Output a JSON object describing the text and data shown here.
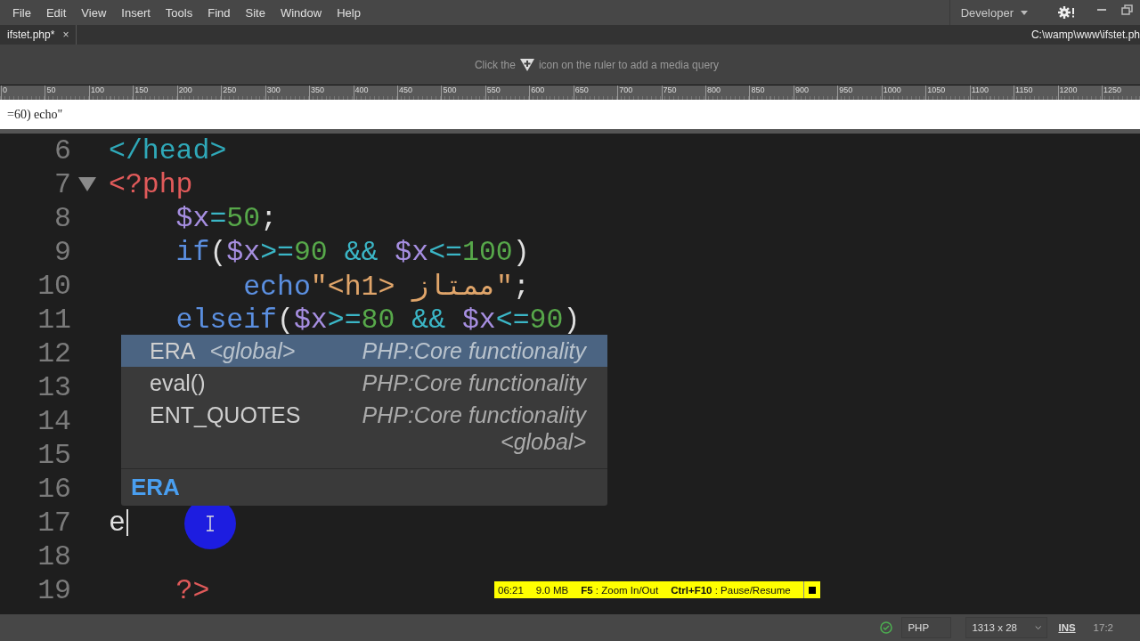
{
  "menu": [
    "File",
    "Edit",
    "View",
    "Insert",
    "Tools",
    "Find",
    "Site",
    "Window",
    "Help"
  ],
  "workspace": {
    "label": "Developer"
  },
  "tab": {
    "title": "ifstet.php*",
    "close": "×",
    "selected": true
  },
  "file_path": "C:\\wamp\\www\\ifstet.ph",
  "media_hint": {
    "before": "Click the",
    "after": "icon on the ruler to add a media query"
  },
  "ruler": [
    "0",
    "50",
    "100",
    "150",
    "200",
    "250",
    "300",
    "350",
    "400",
    "450",
    "500",
    "550",
    "600",
    "650",
    "700",
    "750",
    "800",
    "850",
    "900",
    "950",
    "1000",
    "1050",
    "1100",
    "1150",
    "1200",
    "1250"
  ],
  "live_view": "=60) echo\"",
  "lines": [
    {
      "number": "6",
      "kind": "top",
      "tokens": [
        {
          "kind": "tag",
          "text": "</head>"
        }
      ]
    },
    {
      "number": "7",
      "kind": "top",
      "fold": true,
      "tokens": [
        {
          "kind": "php",
          "text": "<?php"
        }
      ]
    },
    {
      "number": "8",
      "kind": "inner",
      "tokens": [
        {
          "kind": "var",
          "text": "$x"
        },
        {
          "kind": "op",
          "text": "="
        },
        {
          "kind": "num",
          "text": "50"
        },
        {
          "kind": "plain",
          "text": ";"
        }
      ]
    },
    {
      "number": "9",
      "kind": "inner",
      "tokens": [
        {
          "kind": "kw",
          "text": "if"
        },
        {
          "kind": "plain",
          "text": "("
        },
        {
          "kind": "var",
          "text": "$x"
        },
        {
          "kind": "op",
          "text": ">="
        },
        {
          "kind": "num",
          "text": "90"
        },
        {
          "kind": "opsp",
          "text": "&&"
        },
        {
          "kind": "var",
          "text": "$x"
        },
        {
          "kind": "op",
          "text": "<="
        },
        {
          "kind": "num",
          "text": "100"
        },
        {
          "kind": "plain",
          "text": ")"
        }
      ]
    },
    {
      "number": "10",
      "kind": "deep",
      "tokens": [
        {
          "kind": "kw",
          "text": "echo"
        },
        {
          "kind": "str",
          "text": "\"<h1> ممتاز\""
        },
        {
          "kind": "plain",
          "text": ";"
        }
      ]
    },
    {
      "number": "11",
      "kind": "inner",
      "tokens": [
        {
          "kind": "kw",
          "text": "elseif"
        },
        {
          "kind": "plain",
          "text": "("
        },
        {
          "kind": "var",
          "text": "$x"
        },
        {
          "kind": "op",
          "text": ">="
        },
        {
          "kind": "num",
          "text": "80"
        },
        {
          "kind": "opsp",
          "text": "&&"
        },
        {
          "kind": "var",
          "text": "$x"
        },
        {
          "kind": "op",
          "text": "<="
        },
        {
          "kind": "num",
          "text": "90"
        },
        {
          "kind": "plain",
          "text": ")"
        }
      ]
    },
    {
      "number": "12",
      "kind": "top"
    },
    {
      "number": "13",
      "kind": "top"
    },
    {
      "number": "14",
      "kind": "top"
    },
    {
      "number": "15",
      "kind": "top"
    },
    {
      "number": "16",
      "kind": "top"
    },
    {
      "number": "17",
      "kind": "top",
      "caret": true,
      "tokens": [
        {
          "kind": "plain",
          "text": "e"
        }
      ]
    },
    {
      "number": "18",
      "kind": "top"
    },
    {
      "number": "19",
      "kind": "inner",
      "tokens": [
        {
          "kind": "php",
          "text": "?>"
        }
      ]
    }
  ],
  "completion": {
    "items": [
      {
        "name": "ERA",
        "scope": "<global>",
        "source": "PHP:Core functionality",
        "selected": true
      },
      {
        "name": "eval()",
        "source": "PHP:Core functionality",
        "selected": false
      },
      {
        "name": "ENT_QUOTES",
        "source": "PHP:Core functionality <global>",
        "selected": false
      }
    ],
    "preview": "ERA"
  },
  "recorder": {
    "time": "06:21",
    "size": "9.0 MB",
    "hints": [
      "**F5** : Zoom In/Out",
      "**Ctrl+F10** : Pause/Resume"
    ]
  },
  "status_bar": {
    "valid": true,
    "language": "PHP",
    "size": "1313 x 28",
    "mode": "INS",
    "position": "17:2"
  }
}
